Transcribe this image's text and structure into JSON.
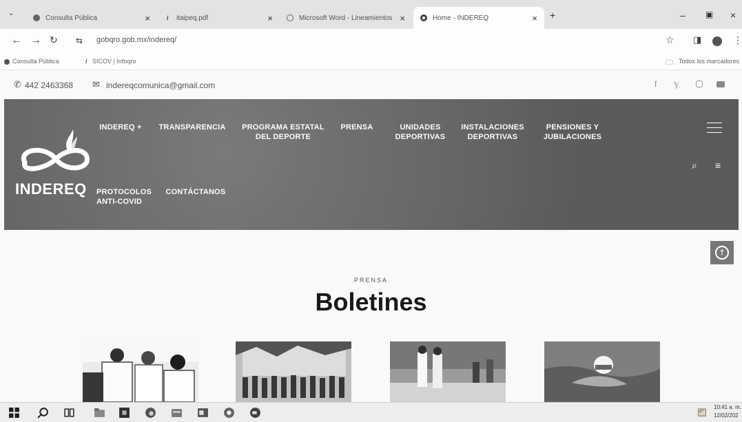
{
  "browser": {
    "tabs": [
      {
        "title": "Consulta Pública"
      },
      {
        "title": "itaipeq.pdf"
      },
      {
        "title": "Microsoft Word - Lineamientos"
      },
      {
        "title": "Home - INDEREQ"
      }
    ],
    "url": "gobqro.gob.mx/indereq/",
    "bookmarks": [
      "Consulta Pública",
      "SICOV | Infoqro"
    ],
    "all_bookmarks": "Todos los marcadores"
  },
  "contact": {
    "phone": "442 2463368",
    "email": "indereqcomunica@gmail.com"
  },
  "brand": {
    "name": "INDEREQ"
  },
  "nav": {
    "row1": [
      "INDEREQ +",
      "TRANSPARENCIA",
      "PROGRAMA ESTATAL\nDEL DEPORTE",
      "PRENSA",
      "UNIDADES\nDEPORTIVAS",
      "INSTALACIONES\nDEPORTIVAS",
      "PENSIONES Y\nJUBILACIONES"
    ],
    "row2": [
      "PROTOCOLOS\nANTI-COVID",
      "CONTÁCTANOS"
    ]
  },
  "section": {
    "kicker": "PRENSA",
    "title": "Boletines"
  },
  "taskbar": {
    "time": "10:41 a. m.",
    "date": "12/02/202"
  }
}
